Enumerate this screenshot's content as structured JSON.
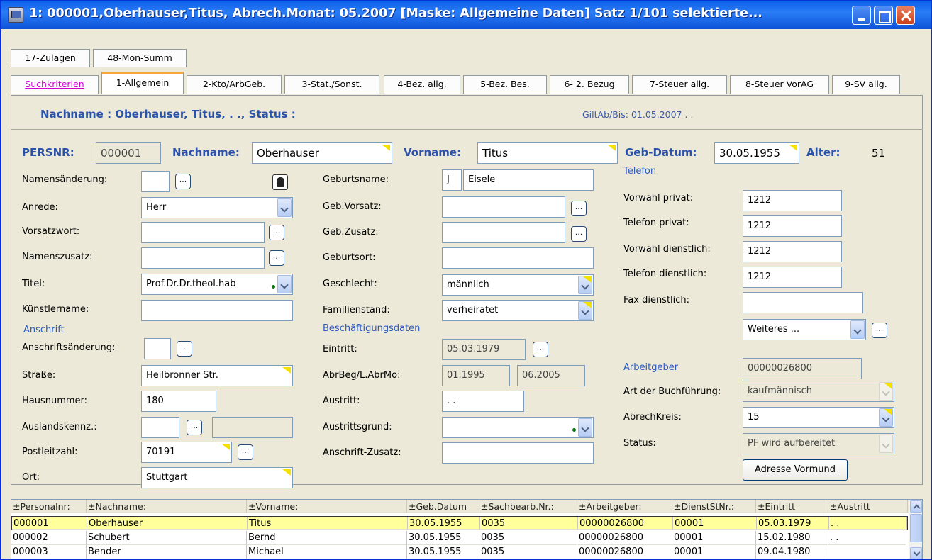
{
  "window": {
    "title": "1: 000001,Oberhauser,Titus, Abrech.Monat: 05.2007   [Maske: Allgemeine Daten]   Satz 1/101 selektierte..."
  },
  "tabs_row1": [
    "17-Zulagen",
    "48-Mon-Summ"
  ],
  "tabs_row2": [
    "Suchkriterien",
    "1-Allgemein",
    "2-Kto/ArbGeb.",
    "3-Stat./Sonst.",
    "4-Bez. allg.",
    "5-Bez. Bes.",
    "6- 2. Bezug",
    "7-Steuer allg.",
    "8-Steuer VorAG",
    "9-SV allg."
  ],
  "header": {
    "name_line": "Nachname : Oberhauser,  Titus,  .  .,  Status :",
    "gilt": "GiltAb/Bis: 01.05.2007       .  ."
  },
  "top": {
    "persnr_label": "PERSNR:",
    "persnr": "000001",
    "nachname_label": "Nachname:",
    "nachname": "Oberhauser",
    "vorname_label": "Vorname:",
    "vorname": "Titus",
    "geb_label": "Geb-Datum:",
    "geb": "30.05.1955",
    "alter_label": "Alter:",
    "alter": "51"
  },
  "left": {
    "namensaenderung": "Namensänderung:",
    "anrede": "Anrede:",
    "anrede_val": "Herr",
    "vorsatzwort": "Vorsatzwort:",
    "namenszusatz": "Namenszusatz:",
    "titel": "Titel:",
    "titel_val": "Prof.Dr.Dr.theol.hab",
    "kuenstlername": "Künstlername:",
    "anschrift": "Anschrift",
    "anschriftsaenderung": "Anschriftsänderung:",
    "strasse": "Straße:",
    "strasse_val": "Heilbronner Str.",
    "hausnummer": "Hausnummer:",
    "hausnummer_val": "180",
    "auslandskennz": "Auslandskennz.:",
    "plz": "Postleitzahl:",
    "plz_val": "70191",
    "ort": "Ort:",
    "ort_val": "Stuttgart"
  },
  "middle": {
    "geburtsname": "Geburtsname:",
    "geburtsname_prefix": "J",
    "geburtsname_val": "Eisele",
    "geb_vorsatz": "Geb.Vorsatz:",
    "geb_zusatz": "Geb.Zusatz:",
    "geburtsort": "Geburtsort:",
    "geschlecht": "Geschlecht:",
    "geschlecht_val": "männlich",
    "familienstand": "Familienstand:",
    "familienstand_val": "verheiratet",
    "beschaeftigung": "Beschäftigungsdaten",
    "eintritt": "Eintritt:",
    "eintritt_val": "05.03.1979",
    "abrbeg": "AbrBeg/L.AbrMo:",
    "abrbeg_val": "01.1995",
    "labrmo_val": "06.2005",
    "austritt": "Austritt:",
    "austritt_val": " .  .",
    "austrittsgrund": "Austrittsgrund:",
    "anschrift_zusatz": "Anschrift-Zusatz:"
  },
  "right": {
    "telefon": "Telefon",
    "vorwahl_privat": "Vorwahl privat:",
    "vorwahl_privat_val": "1212",
    "telefon_privat": "Telefon privat:",
    "telefon_privat_val": "1212",
    "vorwahl_dienst": "Vorwahl dienstlich:",
    "vorwahl_dienst_val": "1212",
    "telefon_dienst": "Telefon dienstlich:",
    "telefon_dienst_val": "1212",
    "fax": "Fax dienstlich:",
    "weiteres": "Weiteres ...",
    "arbeitgeber": "Arbeitgeber",
    "arbeitgeber_val": "00000026800",
    "buchfuehrung": "Art der Buchführung:",
    "buchfuehrung_val": "kaufmännisch",
    "abrechkreis": "AbrechKreis:",
    "abrechkreis_val": "15",
    "status": "Status:",
    "status_val": "PF wird aufbereitet",
    "adresse_btn": "Adresse Vormund"
  },
  "browse_button": "...",
  "grid": {
    "columns": [
      "±Personalnr:",
      "±Nachname:",
      "±Vorname:",
      "±Geb.Datum",
      "±Sachbearb.Nr.:",
      "±Arbeitgeber:",
      "±DienstStNr.:",
      "±Eintritt",
      "±Austritt"
    ],
    "rows": [
      [
        "000001",
        "Oberhauser",
        "Titus",
        "30.05.1955",
        "0035",
        "00000026800",
        "00001",
        "05.03.1979",
        " .  ."
      ],
      [
        "000002",
        "Schubert",
        "Bernd",
        "30.05.1955",
        "0035",
        "00000026800",
        "00001",
        "15.02.1980",
        " .  ."
      ],
      [
        "000003",
        "Bender",
        "Michael",
        "30.05.1955",
        "0035",
        "00000026800",
        "00001",
        "09.04.1980",
        ""
      ]
    ]
  }
}
